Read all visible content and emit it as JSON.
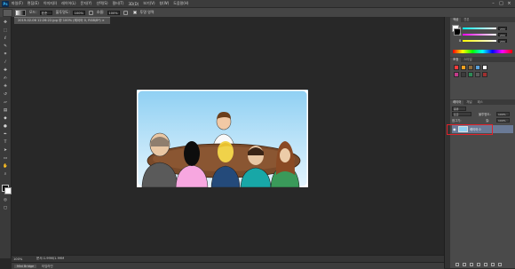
{
  "app": {
    "logo": "Ps"
  },
  "menu": [
    "파일(F)",
    "편집(E)",
    "이미지(I)",
    "레이어(L)",
    "문자(Y)",
    "선택(S)",
    "필터(T)",
    "3D(D)",
    "보기(V)",
    "창(W)",
    "도움말(H)"
  ],
  "window_controls": [
    "–",
    "□",
    "×"
  ],
  "options_bar": {
    "mode_label": "모드:",
    "mode_value": "표준",
    "opacity_label": "불투명도:",
    "opacity_value": "100%",
    "flow_label": "흐름:",
    "flow_value": "100%",
    "transparency_label": "투명 영역",
    "accent": "#ffffff"
  },
  "document": {
    "tab_title": "2019-02-06 12:26:22.jpg @ 100% (레이어 0, RGB/8*) ×"
  },
  "status": {
    "zoom": "100%",
    "info": "문서:1.99M/1.99M"
  },
  "timeline": {
    "tabs": [
      "Mini Bridge",
      "타임라인"
    ]
  },
  "color_panel": {
    "tabs": [
      "색상",
      "견본"
    ],
    "channels": [
      {
        "name": "R",
        "value": "255",
        "color": "#ff4b4b"
      },
      {
        "name": "G",
        "value": "255",
        "color": "#4bd64b"
      },
      {
        "name": "B",
        "value": "255",
        "color": "#4b6bff"
      }
    ]
  },
  "adjust_panel": {
    "tabs": [
      "조정",
      "스타일"
    ],
    "swatch_colors": [
      "#ff3b3b",
      "#f0a020",
      "#8c6a3c",
      "#5aa0d8",
      "#ffffff",
      "#c23a8a",
      "#3c3c3c",
      "#2e8b57",
      "#5a5a5a",
      "#a03030"
    ]
  },
  "layers_panel": {
    "tabs": [
      "레이어",
      "채널",
      "패스"
    ],
    "kind_label": "종류",
    "blend_mode": "표준",
    "opacity_label": "불투명도:",
    "opacity_value": "100%",
    "lock_label": "잠그기:",
    "fill_label": "칠:",
    "fill_value": "100%",
    "layers": [
      {
        "name": "레이어 0",
        "visible": true
      }
    ]
  },
  "tools": [
    "move-tool",
    "marquee-tool",
    "lasso-tool",
    "quick-select-tool",
    "crop-tool",
    "eyedropper-tool",
    "healing-tool",
    "brush-tool",
    "clone-tool",
    "history-brush-tool",
    "eraser-tool",
    "gradient-tool",
    "blur-tool",
    "dodge-tool",
    "pen-tool",
    "type-tool",
    "path-select-tool",
    "shape-tool",
    "hand-tool",
    "zoom-tool"
  ]
}
